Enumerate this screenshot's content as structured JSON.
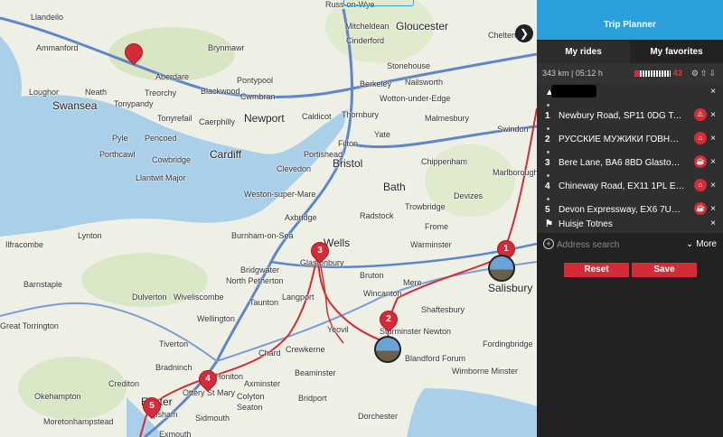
{
  "map": {
    "places": [
      {
        "name": "Llandeilo",
        "cls": ""
      },
      {
        "name": "Ammanford",
        "cls": ""
      },
      {
        "name": "Aberdare",
        "cls": ""
      },
      {
        "name": "Brynmawr",
        "cls": ""
      },
      {
        "name": "Gloucester",
        "cls": "big"
      },
      {
        "name": "Mitcheldean",
        "cls": ""
      },
      {
        "name": "Cinderford",
        "cls": ""
      },
      {
        "name": "Cheltenham",
        "cls": ""
      },
      {
        "name": "Loughor",
        "cls": ""
      },
      {
        "name": "Neath",
        "cls": ""
      },
      {
        "name": "Treorchy",
        "cls": ""
      },
      {
        "name": "Blackwood",
        "cls": ""
      },
      {
        "name": "Pontypool",
        "cls": ""
      },
      {
        "name": "Cwmbran",
        "cls": ""
      },
      {
        "name": "Swansea",
        "cls": "big"
      },
      {
        "name": "Tonypandy",
        "cls": ""
      },
      {
        "name": "Caerphilly",
        "cls": ""
      },
      {
        "name": "Newport",
        "cls": "big"
      },
      {
        "name": "Caldicot",
        "cls": ""
      },
      {
        "name": "Stonehouse",
        "cls": ""
      },
      {
        "name": "Nailsworth",
        "cls": ""
      },
      {
        "name": "Berkeley",
        "cls": ""
      },
      {
        "name": "Wotton-under-Edge",
        "cls": ""
      },
      {
        "name": "Malmesbury",
        "cls": ""
      },
      {
        "name": "Thornbury",
        "cls": ""
      },
      {
        "name": "Tonyrefail",
        "cls": ""
      },
      {
        "name": "Pyle",
        "cls": ""
      },
      {
        "name": "Pencoed",
        "cls": ""
      },
      {
        "name": "Porthcawl",
        "cls": ""
      },
      {
        "name": "Cowbridge",
        "cls": ""
      },
      {
        "name": "Cardiff",
        "cls": "big"
      },
      {
        "name": "Llantwit Major",
        "cls": ""
      },
      {
        "name": "Portishead",
        "cls": ""
      },
      {
        "name": "Clevedon",
        "cls": ""
      },
      {
        "name": "Bristol",
        "cls": "big"
      },
      {
        "name": "Filton",
        "cls": ""
      },
      {
        "name": "Yate",
        "cls": ""
      },
      {
        "name": "Chippenham",
        "cls": ""
      },
      {
        "name": "Swindon",
        "cls": ""
      },
      {
        "name": "Marlborough",
        "cls": ""
      },
      {
        "name": "Weston-super-Mare",
        "cls": ""
      },
      {
        "name": "Axbridge",
        "cls": ""
      },
      {
        "name": "Bath",
        "cls": "big"
      },
      {
        "name": "Radstock",
        "cls": ""
      },
      {
        "name": "Trowbridge",
        "cls": ""
      },
      {
        "name": "Devizes",
        "cls": ""
      },
      {
        "name": "Frome",
        "cls": ""
      },
      {
        "name": "Burnham-on-Sea",
        "cls": ""
      },
      {
        "name": "Wells",
        "cls": "big"
      },
      {
        "name": "Glastonbury",
        "cls": ""
      },
      {
        "name": "Warminster",
        "cls": ""
      },
      {
        "name": "Ilfracombe",
        "cls": ""
      },
      {
        "name": "Lynton",
        "cls": ""
      },
      {
        "name": "Bridgwater",
        "cls": ""
      },
      {
        "name": "North Petherton",
        "cls": ""
      },
      {
        "name": "Bruton",
        "cls": ""
      },
      {
        "name": "Barnstaple",
        "cls": ""
      },
      {
        "name": "Langport",
        "cls": ""
      },
      {
        "name": "Wincanton",
        "cls": ""
      },
      {
        "name": "Mere",
        "cls": ""
      },
      {
        "name": "Salisbury",
        "cls": "big"
      },
      {
        "name": "Dulverton",
        "cls": ""
      },
      {
        "name": "Wiveliscombe",
        "cls": ""
      },
      {
        "name": "Taunton",
        "cls": ""
      },
      {
        "name": "Great Torrington",
        "cls": ""
      },
      {
        "name": "Wellington",
        "cls": ""
      },
      {
        "name": "Shaftesbury",
        "cls": ""
      },
      {
        "name": "Yeovil",
        "cls": ""
      },
      {
        "name": "Sturminster Newton",
        "cls": ""
      },
      {
        "name": "Tiverton",
        "cls": ""
      },
      {
        "name": "Crewkerne",
        "cls": ""
      },
      {
        "name": "Chard",
        "cls": ""
      },
      {
        "name": "Blandford Forum",
        "cls": ""
      },
      {
        "name": "Fordingbridge",
        "cls": ""
      },
      {
        "name": "Bradninch",
        "cls": ""
      },
      {
        "name": "Honiton",
        "cls": ""
      },
      {
        "name": "Axminster",
        "cls": ""
      },
      {
        "name": "Beaminster",
        "cls": ""
      },
      {
        "name": "Wimborne Minster",
        "cls": ""
      },
      {
        "name": "Okehampton",
        "cls": ""
      },
      {
        "name": "Ottery St Mary",
        "cls": ""
      },
      {
        "name": "Colyton",
        "cls": ""
      },
      {
        "name": "Seaton",
        "cls": ""
      },
      {
        "name": "Bridport",
        "cls": ""
      },
      {
        "name": "Moretonhampstead",
        "cls": ""
      },
      {
        "name": "Exeter",
        "cls": "big"
      },
      {
        "name": "Topsham",
        "cls": ""
      },
      {
        "name": "Sidmouth",
        "cls": ""
      },
      {
        "name": "Dorchester",
        "cls": ""
      },
      {
        "name": "Exmouth",
        "cls": ""
      },
      {
        "name": "Russ-on-Wye",
        "cls": ""
      },
      {
        "name": "Crediton",
        "cls": ""
      }
    ],
    "pins": [
      "1",
      "2",
      "3",
      "4",
      "5"
    ],
    "collapse_icon": "chevron-right"
  },
  "panel": {
    "title": "Trip Planner",
    "tabs": [
      "My rides",
      "My favorites"
    ],
    "distance": "343 km | 05:12 h",
    "elevation_value": "43",
    "stops": [
      {
        "num": "",
        "address": "",
        "icon": "warning"
      },
      {
        "num": "1",
        "address": "Newbury Road, SP11 0DG Test …",
        "icon": "warning"
      },
      {
        "num": "2",
        "address": "РУССКИЕ МУЖИКИ ГОВНО, 6…",
        "icon": "hotel"
      },
      {
        "num": "3",
        "address": "Bere Lane, BA6 8BD Glastonbur…",
        "icon": "food"
      },
      {
        "num": "4",
        "address": "Chineway Road, EX11 1PL East…",
        "icon": "hotel"
      },
      {
        "num": "5",
        "address": "Devon Expressway, EX6 7UY Tei…",
        "icon": "food"
      },
      {
        "num": "",
        "address": "Huisje Totnes",
        "icon": "flag"
      }
    ],
    "search_placeholder": "Address search",
    "more_label": "More",
    "reset_label": "Reset",
    "save_label": "Save"
  }
}
